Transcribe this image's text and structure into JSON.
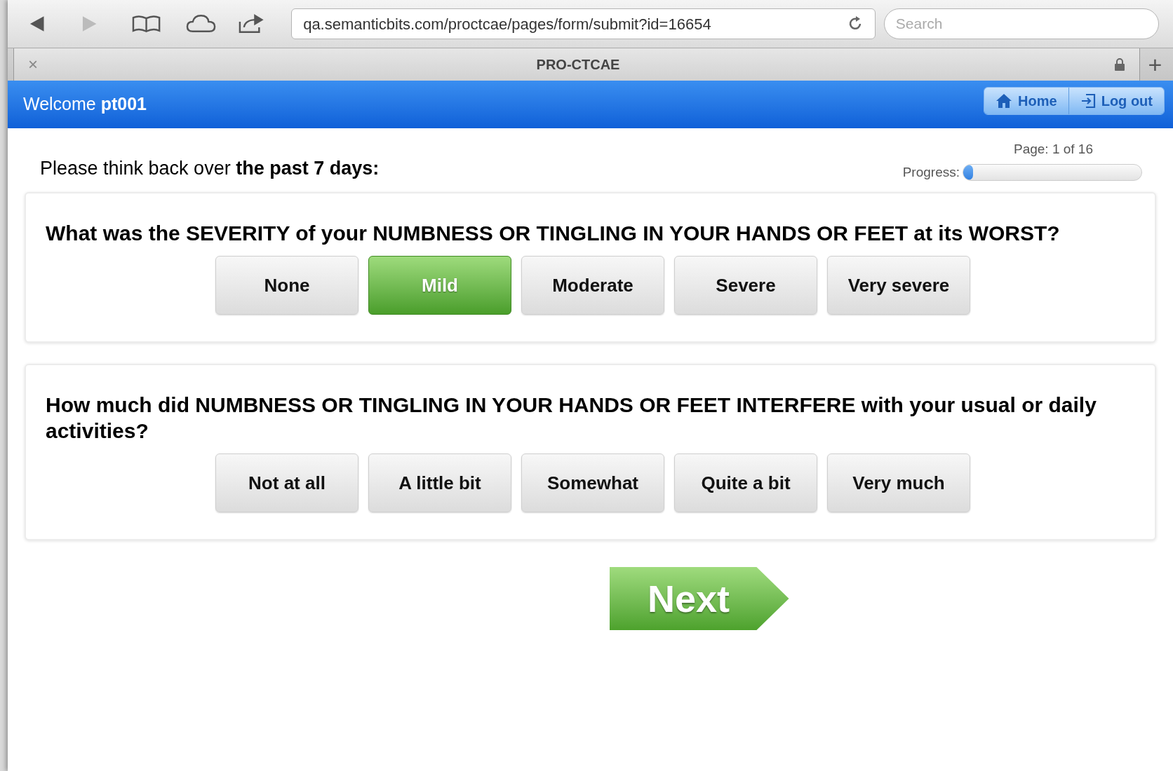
{
  "browser": {
    "url": "qa.semanticbits.com/proctcae/pages/form/submit?id=16654",
    "search": {
      "placeholder": "Search"
    },
    "tab_title": "PRO-CTCAE",
    "close_tab": "×",
    "new_tab": "+"
  },
  "header": {
    "welcome": "Welcome **pt001**",
    "buttons": [
      {
        "label": "Home",
        "kind": "home"
      },
      {
        "label": "Log out",
        "kind": "logout"
      }
    ]
  },
  "intro": "Please think back over **the past 7 days:**",
  "page_indicator": "Page: 1 of 16",
  "progress": {
    "label": "Progress:",
    "level": 0.03
  },
  "questions": [
    {
      "text": "What was the SEVERITY of your NUMBNESS OR TINGLING IN YOUR HANDS OR FEET at its WORST?",
      "options": [
        {
          "label": "None",
          "selected": false
        },
        {
          "label": "Mild",
          "selected": true
        },
        {
          "label": "Moderate",
          "selected": false
        },
        {
          "label": "Severe",
          "selected": false
        },
        {
          "label": "Very severe",
          "selected": false
        }
      ]
    },
    {
      "text": "How much did NUMBNESS OR TINGLING IN YOUR HANDS OR FEET INTERFERE with your usual or daily activities?",
      "options": [
        {
          "label": "Not at all",
          "selected": false
        },
        {
          "label": "A little bit",
          "selected": false
        },
        {
          "label": "Somewhat",
          "selected": false
        },
        {
          "label": "Quite a bit",
          "selected": false
        },
        {
          "label": "Very much",
          "selected": false
        }
      ]
    }
  ],
  "next_button": "Next"
}
